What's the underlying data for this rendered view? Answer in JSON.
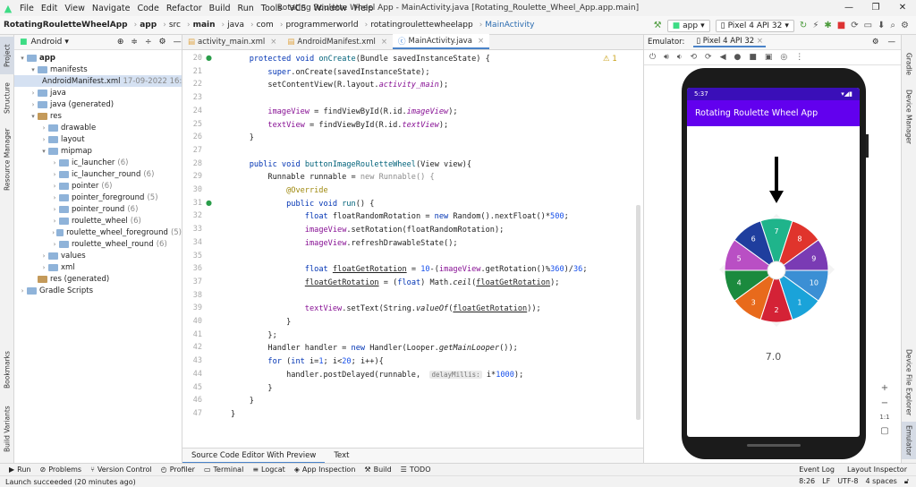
{
  "window": {
    "title": "Rotating Roulette Wheel App - MainActivity.java [Rotating_Roulette_Wheel_App.app.main]",
    "menu": [
      "File",
      "Edit",
      "View",
      "Navigate",
      "Code",
      "Refactor",
      "Build",
      "Run",
      "Tools",
      "VCS",
      "Window",
      "Help"
    ]
  },
  "breadcrumbs": [
    "RotatingRouletteWheelApp",
    "app",
    "src",
    "main",
    "java",
    "com",
    "programmerworld",
    "rotatingroulettewheelapp",
    "MainActivity"
  ],
  "toolbar": {
    "config": "app",
    "device": "Pixel 4 API 32"
  },
  "left_tools": [
    "Project",
    "Structure",
    "Resource Manager",
    "Bookmarks",
    "Build Variants"
  ],
  "right_tools": [
    "Gradle",
    "Device Manager",
    "Device File Explorer",
    "Emulator"
  ],
  "project": {
    "view": "Android",
    "tree": [
      {
        "label": "app",
        "indent": 0,
        "arrow": "▾",
        "type": "fold",
        "bold": true
      },
      {
        "label": "manifests",
        "indent": 1,
        "arrow": "▾",
        "type": "fold"
      },
      {
        "label": "AndroidManifest.xml",
        "indent": 2,
        "arrow": "",
        "type": "xml",
        "note": "17-09-2022 16:53",
        "selected": true
      },
      {
        "label": "java",
        "indent": 1,
        "arrow": "›",
        "type": "fold"
      },
      {
        "label": "java (generated)",
        "indent": 1,
        "arrow": "›",
        "type": "fold"
      },
      {
        "label": "res",
        "indent": 1,
        "arrow": "▾",
        "type": "res"
      },
      {
        "label": "drawable",
        "indent": 2,
        "arrow": "›",
        "type": "fold"
      },
      {
        "label": "layout",
        "indent": 2,
        "arrow": "›",
        "type": "fold"
      },
      {
        "label": "mipmap",
        "indent": 2,
        "arrow": "▾",
        "type": "fold"
      },
      {
        "label": "ic_launcher",
        "indent": 3,
        "arrow": "›",
        "type": "fold",
        "count": "(6)"
      },
      {
        "label": "ic_launcher_round",
        "indent": 3,
        "arrow": "›",
        "type": "fold",
        "count": "(6)"
      },
      {
        "label": "pointer",
        "indent": 3,
        "arrow": "›",
        "type": "fold",
        "count": "(6)"
      },
      {
        "label": "pointer_foreground",
        "indent": 3,
        "arrow": "›",
        "type": "fold",
        "count": "(5)"
      },
      {
        "label": "pointer_round",
        "indent": 3,
        "arrow": "›",
        "type": "fold",
        "count": "(6)"
      },
      {
        "label": "roulette_wheel",
        "indent": 3,
        "arrow": "›",
        "type": "fold",
        "count": "(6)"
      },
      {
        "label": "roulette_wheel_foreground",
        "indent": 3,
        "arrow": "›",
        "type": "fold",
        "count": "(5)"
      },
      {
        "label": "roulette_wheel_round",
        "indent": 3,
        "arrow": "›",
        "type": "fold",
        "count": "(6)"
      },
      {
        "label": "values",
        "indent": 2,
        "arrow": "›",
        "type": "fold"
      },
      {
        "label": "xml",
        "indent": 2,
        "arrow": "›",
        "type": "fold"
      },
      {
        "label": "res (generated)",
        "indent": 1,
        "arrow": "",
        "type": "res"
      },
      {
        "label": "Gradle Scripts",
        "indent": 0,
        "arrow": "›",
        "type": "fold"
      }
    ]
  },
  "editor_tabs": [
    {
      "label": "activity_main.xml",
      "active": false
    },
    {
      "label": "AndroidManifest.xml",
      "active": false
    },
    {
      "label": "MainActivity.java",
      "active": true
    }
  ],
  "warning": "⚠ 1",
  "code_lines": [
    {
      "n": "20",
      "html": "    <span class='kw'>protected void</span> <span class='fn'>onCreate</span>(Bundle savedInstanceState) {"
    },
    {
      "n": "21",
      "html": "        <span class='kw'>super</span>.onCreate(savedInstanceState);"
    },
    {
      "n": "22",
      "html": "        setContentView(R.layout.<span class='it'>activity_main</span>);"
    },
    {
      "n": "23",
      "html": ""
    },
    {
      "n": "24",
      "html": "        <span class='fld'>imageView</span> = findViewById(R.id.<span class='it'>imageView</span>);"
    },
    {
      "n": "25",
      "html": "        <span class='fld'>textView</span> = findViewById(R.id.<span class='it'>textView</span>);"
    },
    {
      "n": "26",
      "html": "    }"
    },
    {
      "n": "27",
      "html": ""
    },
    {
      "n": "28",
      "html": "    <span class='kw'>public void</span> <span class='fn'>buttonImageRouletteWheel</span>(View view){"
    },
    {
      "n": "29",
      "html": "        Runnable runnable = <span class='gray'>new Runnable() {</span>"
    },
    {
      "n": "30",
      "html": "            <span class='ann'>@Override</span>"
    },
    {
      "n": "31",
      "html": "            <span class='kw'>public void</span> <span class='fn'>run</span>() {"
    },
    {
      "n": "32",
      "html": "                <span class='kw'>float</span> floatRandomRotation = <span class='kw'>new</span> Random().nextFloat()*<span class='num'>500</span>;"
    },
    {
      "n": "33",
      "html": "                <span class='fld'>imageView</span>.setRotation(floatRandomRotation);"
    },
    {
      "n": "34",
      "html": "                <span class='fld'>imageView</span>.refreshDrawableState();"
    },
    {
      "n": "35",
      "html": ""
    },
    {
      "n": "36",
      "html": "                <span class='kw'>float</span> <span class='ul'>floatGetRotation</span> = <span class='num'>10</span>-(<span class='fld'>imageView</span>.getRotation()%<span class='num'>360</span>)/<span class='num'>36</span>;"
    },
    {
      "n": "37",
      "html": "                <span class='ul'>floatGetRotation</span> = (<span class='kw'>float</span>) Math.<span style='font-style:italic'>ceil</span>(<span class='ul'>floatGetRotation</span>);"
    },
    {
      "n": "38",
      "html": ""
    },
    {
      "n": "39",
      "html": "                <span class='fld'>textView</span>.setText(String.<span style='font-style:italic'>valueOf</span>(<span class='ul'>floatGetRotation</span>));"
    },
    {
      "n": "40",
      "html": "            }"
    },
    {
      "n": "41",
      "html": "        };"
    },
    {
      "n": "42",
      "html": "        Handler handler = <span class='kw'>new</span> Handler(Looper.<span style='font-style:italic'>getMainLooper</span>());"
    },
    {
      "n": "43",
      "html": "        <span class='kw'>for</span> (<span class='kw'>int</span> i=<span class='num'>1</span>; i&lt;<span class='num'>20</span>; i++){"
    },
    {
      "n": "44",
      "html": "            handler.postDelayed(runnable,  <span class='hint'>delayMillis:</span> i*<span class='num'>1000</span>);"
    },
    {
      "n": "45",
      "html": "        }"
    },
    {
      "n": "46",
      "html": "    }"
    },
    {
      "n": "47",
      "html": "}"
    }
  ],
  "editor_bottom_tabs": [
    "Source Code Editor With Preview",
    "Text"
  ],
  "emulator": {
    "label": "Emulator:",
    "device": "Pixel 4 API 32",
    "time": "5:37",
    "app_title": "Rotating Roulette Wheel App",
    "result": "7.0",
    "wheel_numbers": [
      "1",
      "2",
      "3",
      "4",
      "5",
      "6",
      "7",
      "8",
      "9",
      "10"
    ],
    "wheel_colors": [
      "#1fb48b",
      "#e0342c",
      "#7a3bb4",
      "#3b8fd4",
      "#1aa3d9",
      "#d42236",
      "#e86a1c",
      "#1b8a3e",
      "#b94fc4",
      "#1f3e9e"
    ],
    "zoom_ratio": "1:1"
  },
  "bottom_tools": [
    "Run",
    "Problems",
    "Version Control",
    "Profiler",
    "Terminal",
    "Logcat",
    "App Inspection",
    "Build",
    "TODO"
  ],
  "bottom_right_tools": [
    "Event Log",
    "Layout Inspector"
  ],
  "status": {
    "message": "Launch succeeded (20 minutes ago)",
    "position": "8:26",
    "line_sep": "LF",
    "encoding": "UTF-8",
    "indent": "4 spaces"
  }
}
